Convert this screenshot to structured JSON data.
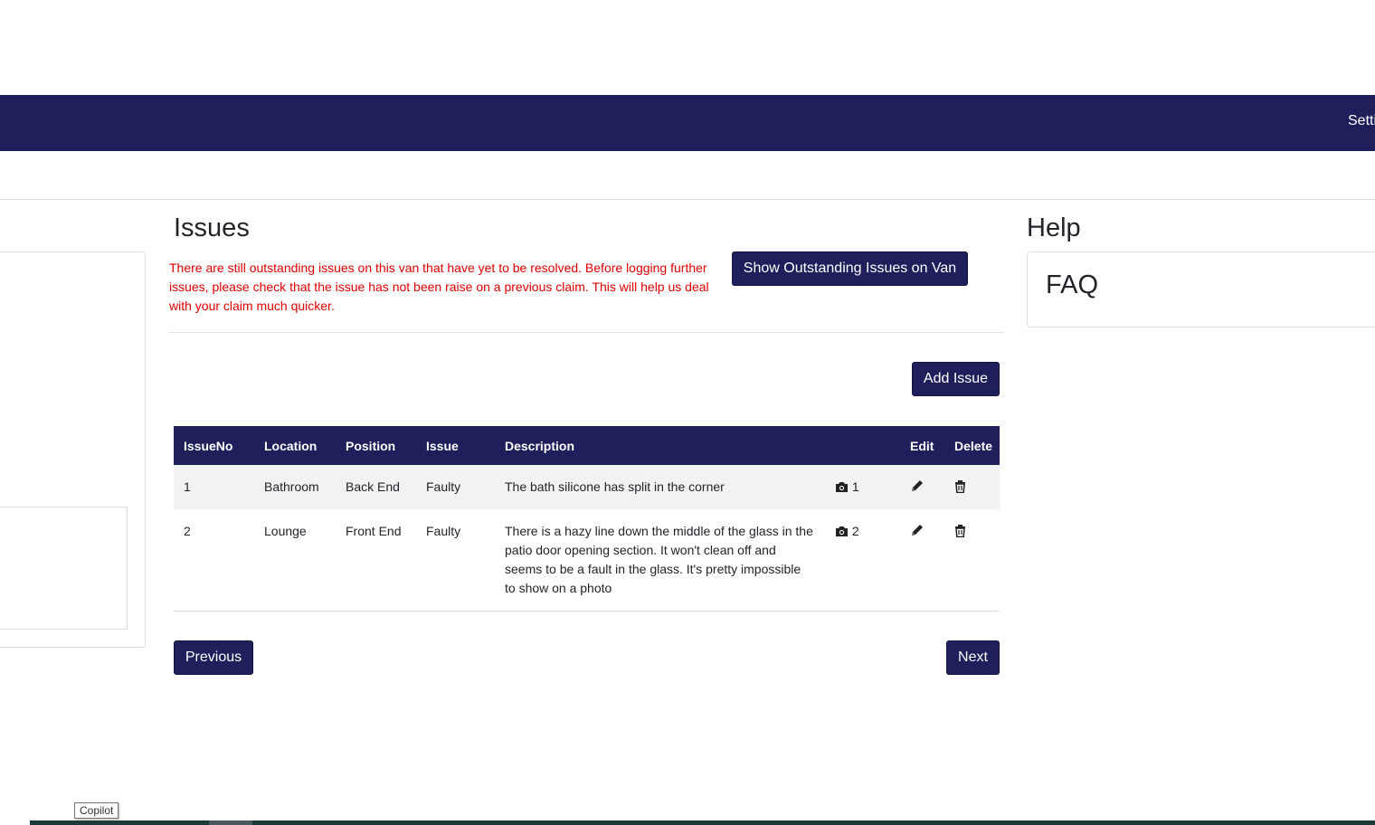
{
  "nav": {
    "settings_label": "Setti"
  },
  "issues": {
    "title": "Issues",
    "warning": "There are still outstanding issues on this van that have yet to be resolved. Before logging further issues, please check that the issue has not been raise on a previous claim. This will help us deal with your claim much quicker.",
    "show_outstanding_label": "Show Outstanding Issues on Van",
    "add_issue_label": "Add Issue",
    "columns": [
      "IssueNo",
      "Location",
      "Position",
      "Issue",
      "Description",
      "",
      "Edit",
      "Delete"
    ],
    "rows": [
      {
        "no": "1",
        "location": "Bathroom",
        "position": "Back End",
        "issue": "Faulty",
        "description": "The bath silicone has split in the corner",
        "photos": "1",
        "photo_icon": "camera-icon",
        "edit_icon": "pencil-icon",
        "delete_icon": "trash-icon"
      },
      {
        "no": "2",
        "location": "Lounge",
        "position": "Front End",
        "issue": "Faulty",
        "description": "There is a hazy line down the middle of the glass in the patio door opening section. It won't clean off and seems to be a fault in the glass. It's pretty impossible to show on a photo",
        "photos": "2",
        "photo_icon": "camera-icon",
        "edit_icon": "pencil-icon",
        "delete_icon": "trash-icon"
      }
    ],
    "previous_label": "Previous",
    "next_label": "Next"
  },
  "help": {
    "title": "Help",
    "faq_title": "FAQ"
  },
  "tooltip": {
    "copilot": "Copilot"
  },
  "colors": {
    "brand": "#1f1f5c",
    "warning": "#e00000",
    "row_alt": "#f2f2f2"
  }
}
